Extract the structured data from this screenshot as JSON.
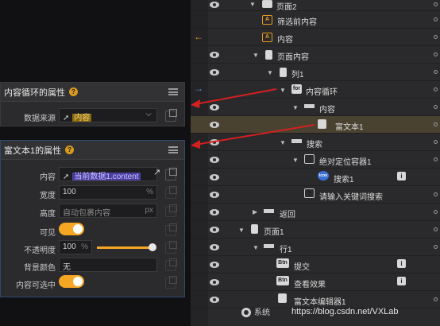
{
  "loop_panel": {
    "title": "内容循环的属性",
    "help": "?",
    "data_source_label": "数据来源",
    "data_source_value": "内容"
  },
  "rich_panel": {
    "title": "富文本1的属性",
    "help": "?",
    "content_label": "内容",
    "content_value": "当前数据1.content",
    "width_label": "宽度",
    "width_value": "100",
    "width_unit": "%",
    "height_label": "高度",
    "height_value": "自动包裹内容",
    "height_unit": "px",
    "visible_label": "可见",
    "opacity_label": "不透明度",
    "opacity_value": "100",
    "opacity_unit": "%",
    "opacity_level": 1.0,
    "bg_label": "背景颜色",
    "bg_value": "无",
    "selectable_label": "内容可选中"
  },
  "tree": {
    "nodes": [
      "页面2",
      "筛选前内容",
      "内容",
      "页面内容",
      "列1",
      "内容循环",
      "内容",
      "富文本1",
      "搜索",
      "绝对定位容器1",
      "搜索1",
      "请输入关键词搜索",
      "返回",
      "页面1",
      "行1",
      "提交",
      "查看效果",
      "富文本编辑器1"
    ],
    "icon_labels": {
      "for": "for",
      "btn": "Btn",
      "icon": "Icon"
    }
  },
  "bottom": {
    "system_label": "系统",
    "watermark": "https://blog.csdn.net/VXLab"
  },
  "colors": {
    "accent": "#f5a623",
    "arrow": "#d42020",
    "selected_row": "#4a4230"
  }
}
